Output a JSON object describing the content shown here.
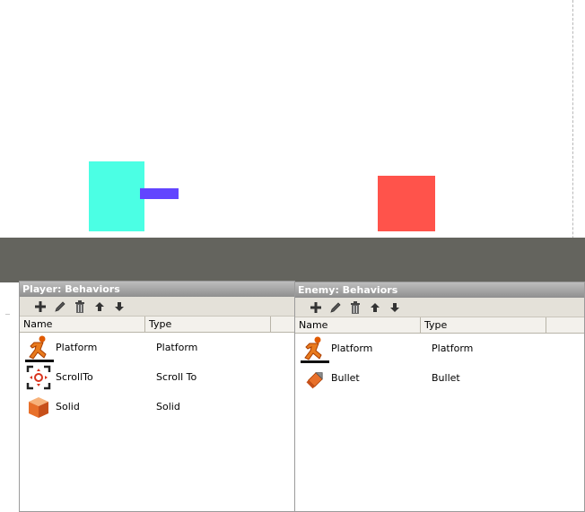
{
  "player_panel": {
    "title": "Player: Behaviors",
    "columns": [
      "Name",
      "Type"
    ],
    "rows": [
      {
        "name": "Platform",
        "type": "Platform",
        "icon": "platform-runner-icon"
      },
      {
        "name": "ScrollTo",
        "type": "Scroll To",
        "icon": "scroll-to-icon"
      },
      {
        "name": "Solid",
        "type": "Solid",
        "icon": "solid-cube-icon"
      }
    ]
  },
  "enemy_panel": {
    "title": "Enemy: Behaviors",
    "columns": [
      "Name",
      "Type"
    ],
    "rows": [
      {
        "name": "Platform",
        "type": "Platform",
        "icon": "platform-runner-icon"
      },
      {
        "name": "Bullet",
        "type": "Bullet",
        "icon": "bullet-icon"
      }
    ]
  },
  "toolbar_buttons": [
    "add-icon",
    "edit-pencil-icon",
    "delete-trash-icon",
    "move-up-icon",
    "move-down-icon"
  ],
  "colors": {
    "player": "#4bffe4",
    "gun": "#6245ff",
    "enemy": "#ff534b",
    "ground": "#64645e"
  }
}
